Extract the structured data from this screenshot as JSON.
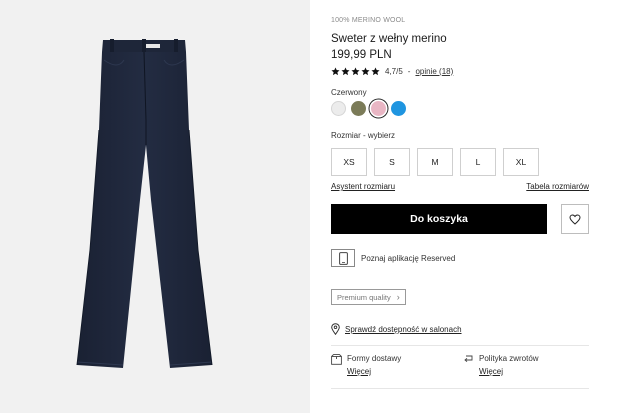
{
  "product": {
    "eyebrow": "100% MERINO WOOL",
    "title": "Sweter z wełny merino",
    "price": "199,99 PLN"
  },
  "rating": {
    "stars": 5,
    "score": "4,7/5",
    "separator": "-",
    "reviews_link": "opinie (18)"
  },
  "colors": {
    "label": "Czerwony",
    "swatches": [
      {
        "name": "light-grey",
        "hex": "#ececec",
        "selected": false
      },
      {
        "name": "olive",
        "hex": "#7b7b58",
        "selected": false
      },
      {
        "name": "pink",
        "hex": "#e9b6c4",
        "selected": true
      },
      {
        "name": "blue",
        "hex": "#1f95e0",
        "selected": false
      }
    ]
  },
  "sizes": {
    "label": "Rozmiar -  wybierz",
    "options": [
      "XS",
      "S",
      "M",
      "L",
      "XL"
    ]
  },
  "links": {
    "size_assistant": "Asystent rozmiaru",
    "size_table": "Tabela rozmiarów"
  },
  "actions": {
    "add_to_cart": "Do koszyka",
    "wishlist_icon": "heart-icon"
  },
  "app_promo": {
    "label": "Poznaj aplikację Reserved",
    "icon": "phone-icon"
  },
  "premium": {
    "label": "Premium quality",
    "icon": "chevron-right-icon"
  },
  "store_availability": {
    "label": "Sprawdź dostępność w salonach",
    "icon": "location-pin-icon"
  },
  "policies": [
    {
      "title": "Formy dostawy",
      "more": "Więcej",
      "icon": "delivery-box-icon"
    },
    {
      "title": "Polityka zwrotów",
      "more": "Więcej",
      "icon": "return-arrow-icon"
    }
  ],
  "colors_theme": {
    "gallery_bg": "#f1f1f1",
    "denim": "#1c2436",
    "button_bg": "#000000",
    "button_text": "#ffffff"
  }
}
